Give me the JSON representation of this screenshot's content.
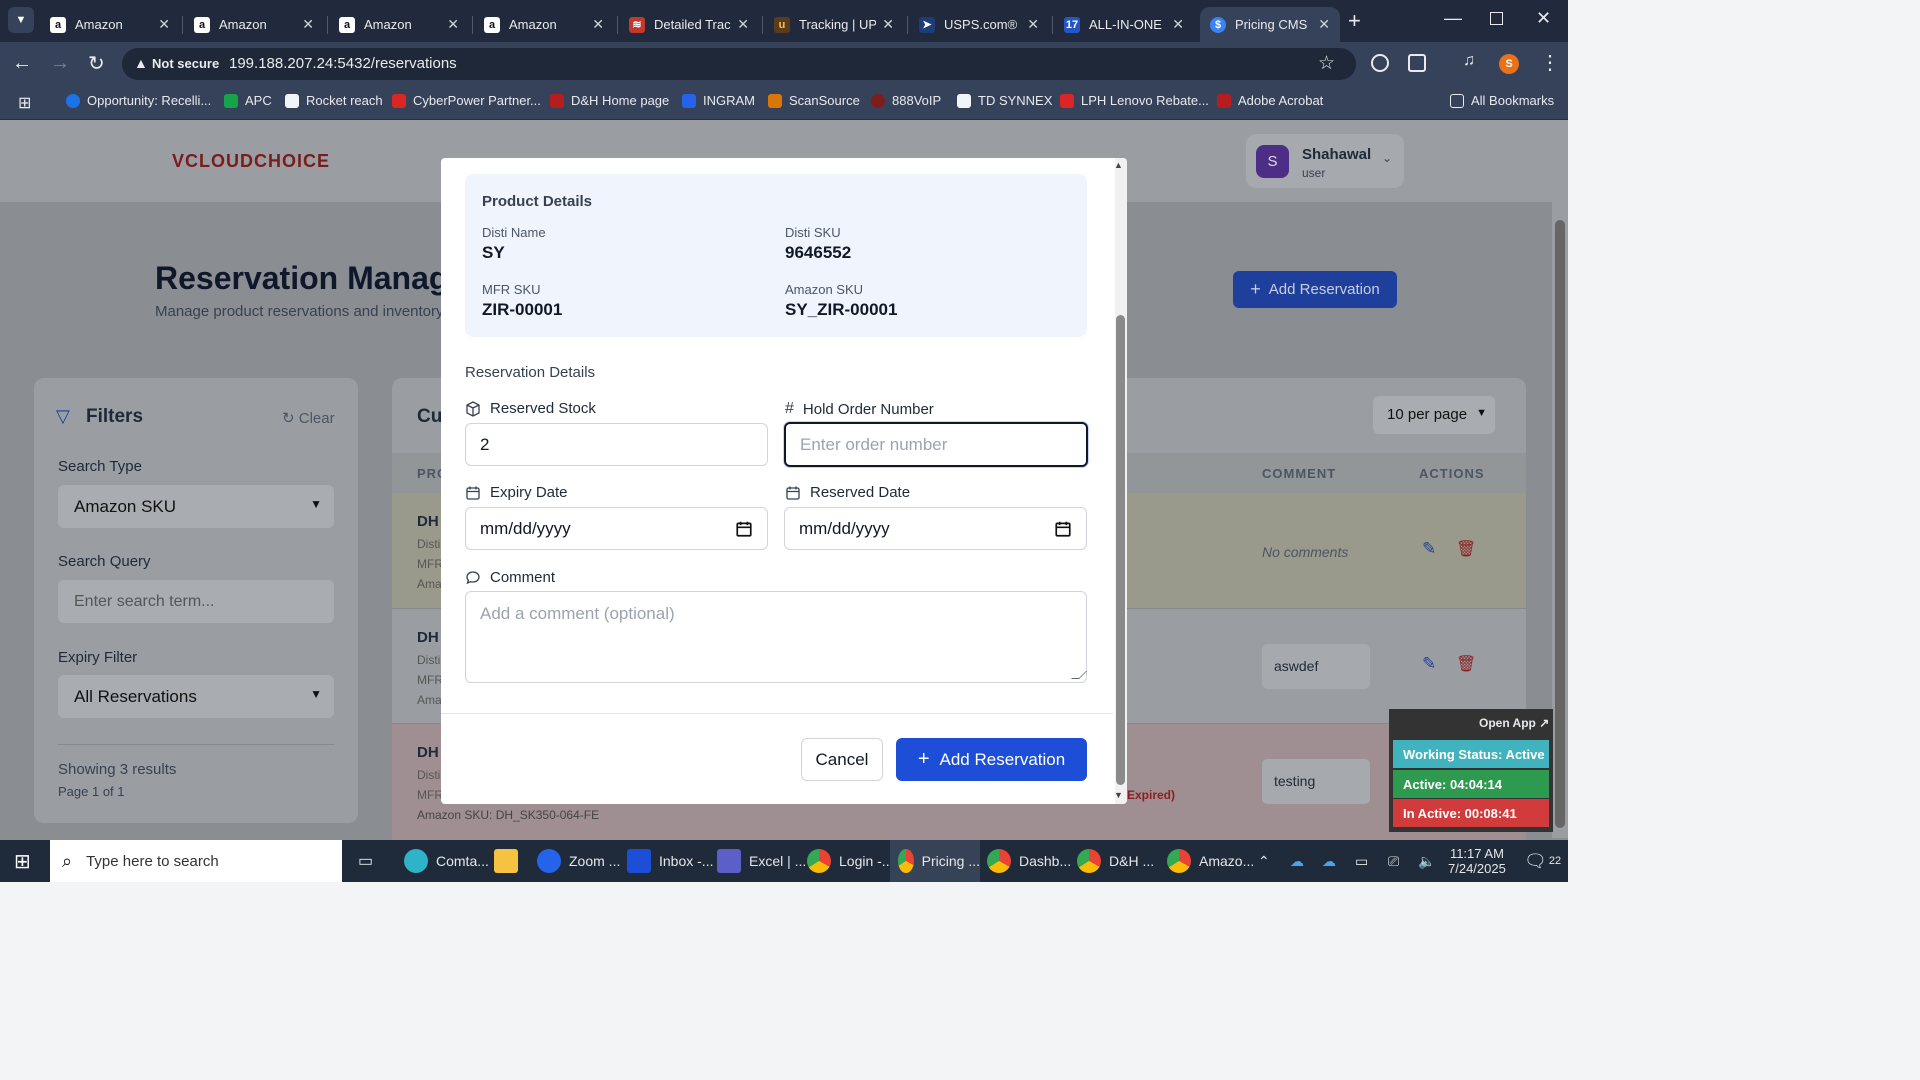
{
  "browser": {
    "tabs": [
      {
        "title": "Amazon",
        "icon": "amazon-icon"
      },
      {
        "title": "Amazon",
        "icon": "amazon-icon"
      },
      {
        "title": "Amazon",
        "icon": "amazon-icon"
      },
      {
        "title": "Amazon",
        "icon": "amazon-icon"
      },
      {
        "title": "Detailed Trac",
        "icon": "tracking-icon"
      },
      {
        "title": "Tracking | UP",
        "icon": "ups-icon"
      },
      {
        "title": "USPS.com®",
        "icon": "usps-icon"
      },
      {
        "title": "ALL-IN-ONE",
        "icon": "17track-icon"
      },
      {
        "title": "Pricing CMS",
        "icon": "pricing-icon"
      }
    ],
    "security": "Not secure",
    "url": "199.188.207.24:5432/reservations",
    "bookmarks": [
      "Opportunity: Recelli...",
      "APC",
      "Rocket reach",
      "CyberPower Partner...",
      "D&H Home page",
      "INGRAM",
      "ScanSource",
      "888VoIP",
      "TD SYNNEX",
      "LPH Lenovo Rebate...",
      "Adobe Acrobat"
    ],
    "all_bookmarks": "All Bookmarks",
    "profile_initial": "S"
  },
  "app": {
    "logo": "CLOUDCHOICE",
    "user": {
      "initial": "S",
      "name": "Shahawal",
      "role": "user"
    },
    "title": "Reservation Manage",
    "subtitle": "Manage product reservations and inventory h",
    "add_button": "Add Reservation",
    "filters": {
      "heading": "Filters",
      "clear": "Clear",
      "search_type_label": "Search Type",
      "search_type_value": "Amazon SKU",
      "search_query_label": "Search Query",
      "search_query_placeholder": "Enter search term...",
      "expiry_label": "Expiry Filter",
      "expiry_value": "All Reservations",
      "showing": "Showing 3 results",
      "page": "Page 1 of 1"
    },
    "table": {
      "title_partial": "Cu",
      "per_page": "10 per page",
      "col_product": "PRO",
      "col_comment": "COMMENT",
      "col_actions": "ACTIONS",
      "rows": [
        {
          "prefix": "DH",
          "comment": "No comments"
        },
        {
          "prefix": "DH",
          "comment": "aswdef"
        },
        {
          "prefix": "DH",
          "comment": "testing",
          "status_tail": "Expired)",
          "amazon_sku_label": "Amazon SKU:",
          "amazon_sku": "DH_SK350-064-FE"
        }
      ],
      "row_line_labels": [
        "Disti",
        "MFR",
        "Ama"
      ]
    }
  },
  "modal": {
    "product_details_title": "Product Details",
    "disti_name_label": "Disti Name",
    "disti_name": "SY",
    "disti_sku_label": "Disti SKU",
    "disti_sku": "9646552",
    "mfr_sku_label": "MFR SKU",
    "mfr_sku": "ZIR-00001",
    "amazon_sku_label": "Amazon SKU",
    "amazon_sku": "SY_ZIR-00001",
    "reservation_details_title": "Reservation Details",
    "reserved_stock_label": "Reserved Stock",
    "reserved_stock_value": "2",
    "hold_order_label": "Hold Order Number",
    "hold_order_placeholder": "Enter order number",
    "expiry_date_label": "Expiry Date",
    "expiry_date_placeholder": "mm/dd/yyyy",
    "reserved_date_label": "Reserved Date",
    "reserved_date_placeholder": "mm/dd/yyyy",
    "comment_label": "Comment",
    "comment_placeholder": "Add a comment (optional)",
    "cancel": "Cancel",
    "submit": "Add Reservation"
  },
  "widget": {
    "open_app": "Open App ↗",
    "working_status": "Working Status: Active",
    "active": "Active: 04:04:14",
    "inactive": "In Active: 00:08:41"
  },
  "taskbar": {
    "search_placeholder": "Type here to search",
    "apps": [
      "Comta...",
      "Zoom ...",
      "Inbox -...",
      "Excel | ...",
      "Login -...",
      "Pricing ...",
      "Dashb...",
      "D&H ...",
      "Amazo..."
    ],
    "time": "11:17 AM",
    "date": "7/24/2025",
    "notifications": "22"
  },
  "colors": {
    "primary": "#1d4ed8",
    "danger": "#dc2626",
    "status_active": "#2e9a4f",
    "status_inactive": "#d23b3b",
    "working": "#40b3bf"
  }
}
